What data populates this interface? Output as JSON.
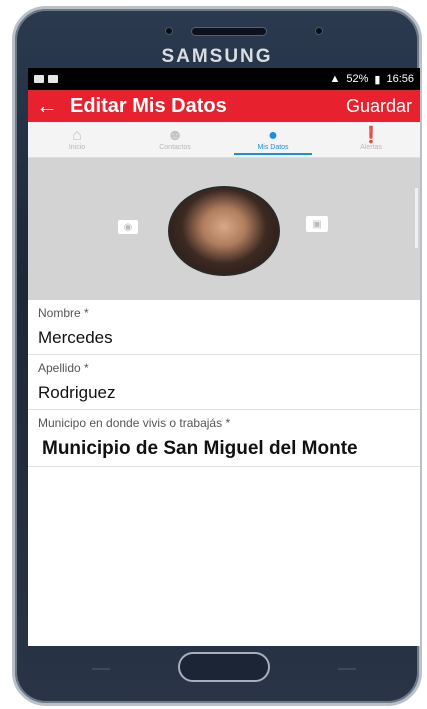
{
  "device": {
    "brand": "SAMSUNG"
  },
  "status_bar": {
    "battery": "52%",
    "time": "16:56"
  },
  "app_bar": {
    "back_icon": "arrow-left-icon",
    "title": "Editar Mis Datos",
    "save_label": "Guardar"
  },
  "tabs": [
    {
      "label": "Inicio",
      "icon": "home-icon",
      "active": false
    },
    {
      "label": "Contactos",
      "icon": "contacts-icon",
      "active": false
    },
    {
      "label": "Mis Datos",
      "icon": "person-icon",
      "active": true
    },
    {
      "label": "Alertas",
      "icon": "alert-icon",
      "active": false
    }
  ],
  "profile": {
    "camera_icon": "camera-icon",
    "gallery_icon": "image-icon"
  },
  "form": {
    "nombre": {
      "label": "Nombre *",
      "value": "Mercedes"
    },
    "apellido": {
      "label": "Apellido *",
      "value": "Rodriguez"
    },
    "municipio": {
      "label": "Municipo en donde vivis o trabajás *",
      "value": "Municipio de San Miguel del Monte"
    }
  },
  "colors": {
    "app_bar": "#e8212e",
    "active_tab": "#1a8fe0",
    "photo_bg": "#d3d3d3"
  }
}
